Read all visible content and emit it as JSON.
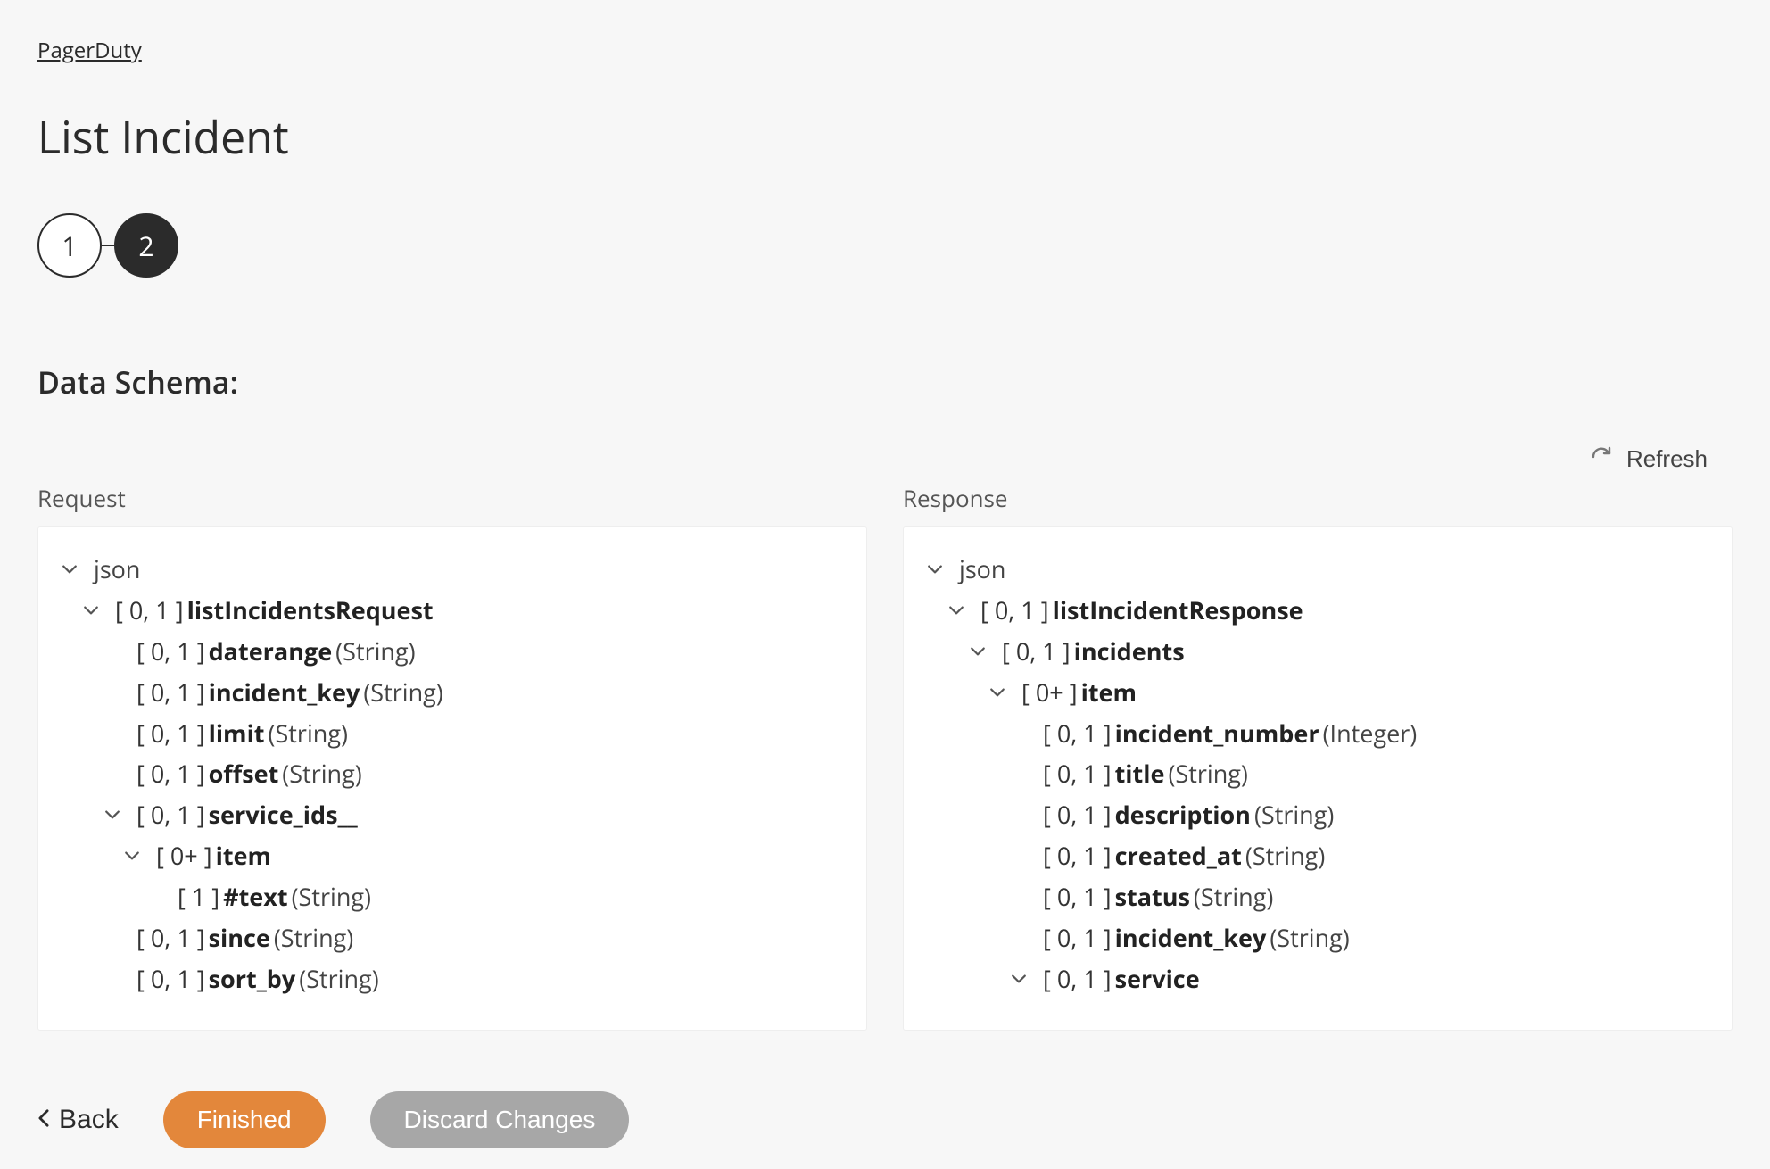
{
  "breadcrumb": {
    "label": "PagerDuty"
  },
  "page": {
    "title": "List Incident"
  },
  "stepper": {
    "steps": [
      "1",
      "2"
    ],
    "active_index": 1
  },
  "section": {
    "title": "Data Schema:"
  },
  "actions": {
    "refresh": "Refresh",
    "back": "Back",
    "finished": "Finished",
    "discard": "Discard Changes"
  },
  "columns": {
    "request_label": "Request",
    "response_label": "Response"
  },
  "request_tree": [
    {
      "indent": 0,
      "chevron": true,
      "card": "",
      "name": "json",
      "type": "",
      "name_weight": "normal"
    },
    {
      "indent": 1,
      "chevron": true,
      "card": "[ 0, 1 ] ",
      "name": "listIncidentsRequest",
      "type": ""
    },
    {
      "indent": 2,
      "chevron": false,
      "card": "[ 0, 1 ] ",
      "name": "daterange",
      "type": "(String)"
    },
    {
      "indent": 2,
      "chevron": false,
      "card": "[ 0, 1 ] ",
      "name": "incident_key",
      "type": "(String)"
    },
    {
      "indent": 2,
      "chevron": false,
      "card": "[ 0, 1 ] ",
      "name": "limit",
      "type": "(String)"
    },
    {
      "indent": 2,
      "chevron": false,
      "card": "[ 0, 1 ] ",
      "name": "offset",
      "type": "(String)"
    },
    {
      "indent": 2,
      "chevron": true,
      "card": "[ 0, 1 ] ",
      "name": "service_ids__",
      "type": ""
    },
    {
      "indent": 3,
      "chevron": true,
      "card": "[ 0+ ] ",
      "name": "item",
      "type": ""
    },
    {
      "indent": 4,
      "chevron": false,
      "card": "[ 1 ] ",
      "name": "#text",
      "type": "(String)"
    },
    {
      "indent": 2,
      "chevron": false,
      "card": "[ 0, 1 ] ",
      "name": "since",
      "type": "(String)"
    },
    {
      "indent": 2,
      "chevron": false,
      "card": "[ 0, 1 ] ",
      "name": "sort_by",
      "type": "(String)"
    }
  ],
  "response_tree": [
    {
      "indent": 0,
      "chevron": true,
      "card": "",
      "name": "json",
      "type": "",
      "name_weight": "normal"
    },
    {
      "indent": 1,
      "chevron": true,
      "card": "[ 0, 1 ] ",
      "name": "listIncidentResponse",
      "type": ""
    },
    {
      "indent": 2,
      "chevron": true,
      "card": "[ 0, 1 ] ",
      "name": "incidents",
      "type": ""
    },
    {
      "indent": 3,
      "chevron": true,
      "card": "[ 0+ ] ",
      "name": "item",
      "type": ""
    },
    {
      "indent": 4,
      "chevron": false,
      "card": "[ 0, 1 ] ",
      "name": "incident_number",
      "type": "(Integer)"
    },
    {
      "indent": 4,
      "chevron": false,
      "card": "[ 0, 1 ] ",
      "name": "title",
      "type": "(String)"
    },
    {
      "indent": 4,
      "chevron": false,
      "card": "[ 0, 1 ] ",
      "name": "description",
      "type": "(String)"
    },
    {
      "indent": 4,
      "chevron": false,
      "card": "[ 0, 1 ] ",
      "name": "created_at",
      "type": "(String)"
    },
    {
      "indent": 4,
      "chevron": false,
      "card": "[ 0, 1 ] ",
      "name": "status",
      "type": "(String)"
    },
    {
      "indent": 4,
      "chevron": false,
      "card": "[ 0, 1 ] ",
      "name": "incident_key",
      "type": "(String)"
    },
    {
      "indent": 4,
      "chevron": true,
      "card": "[ 0, 1 ] ",
      "name": "service",
      "type": ""
    }
  ]
}
